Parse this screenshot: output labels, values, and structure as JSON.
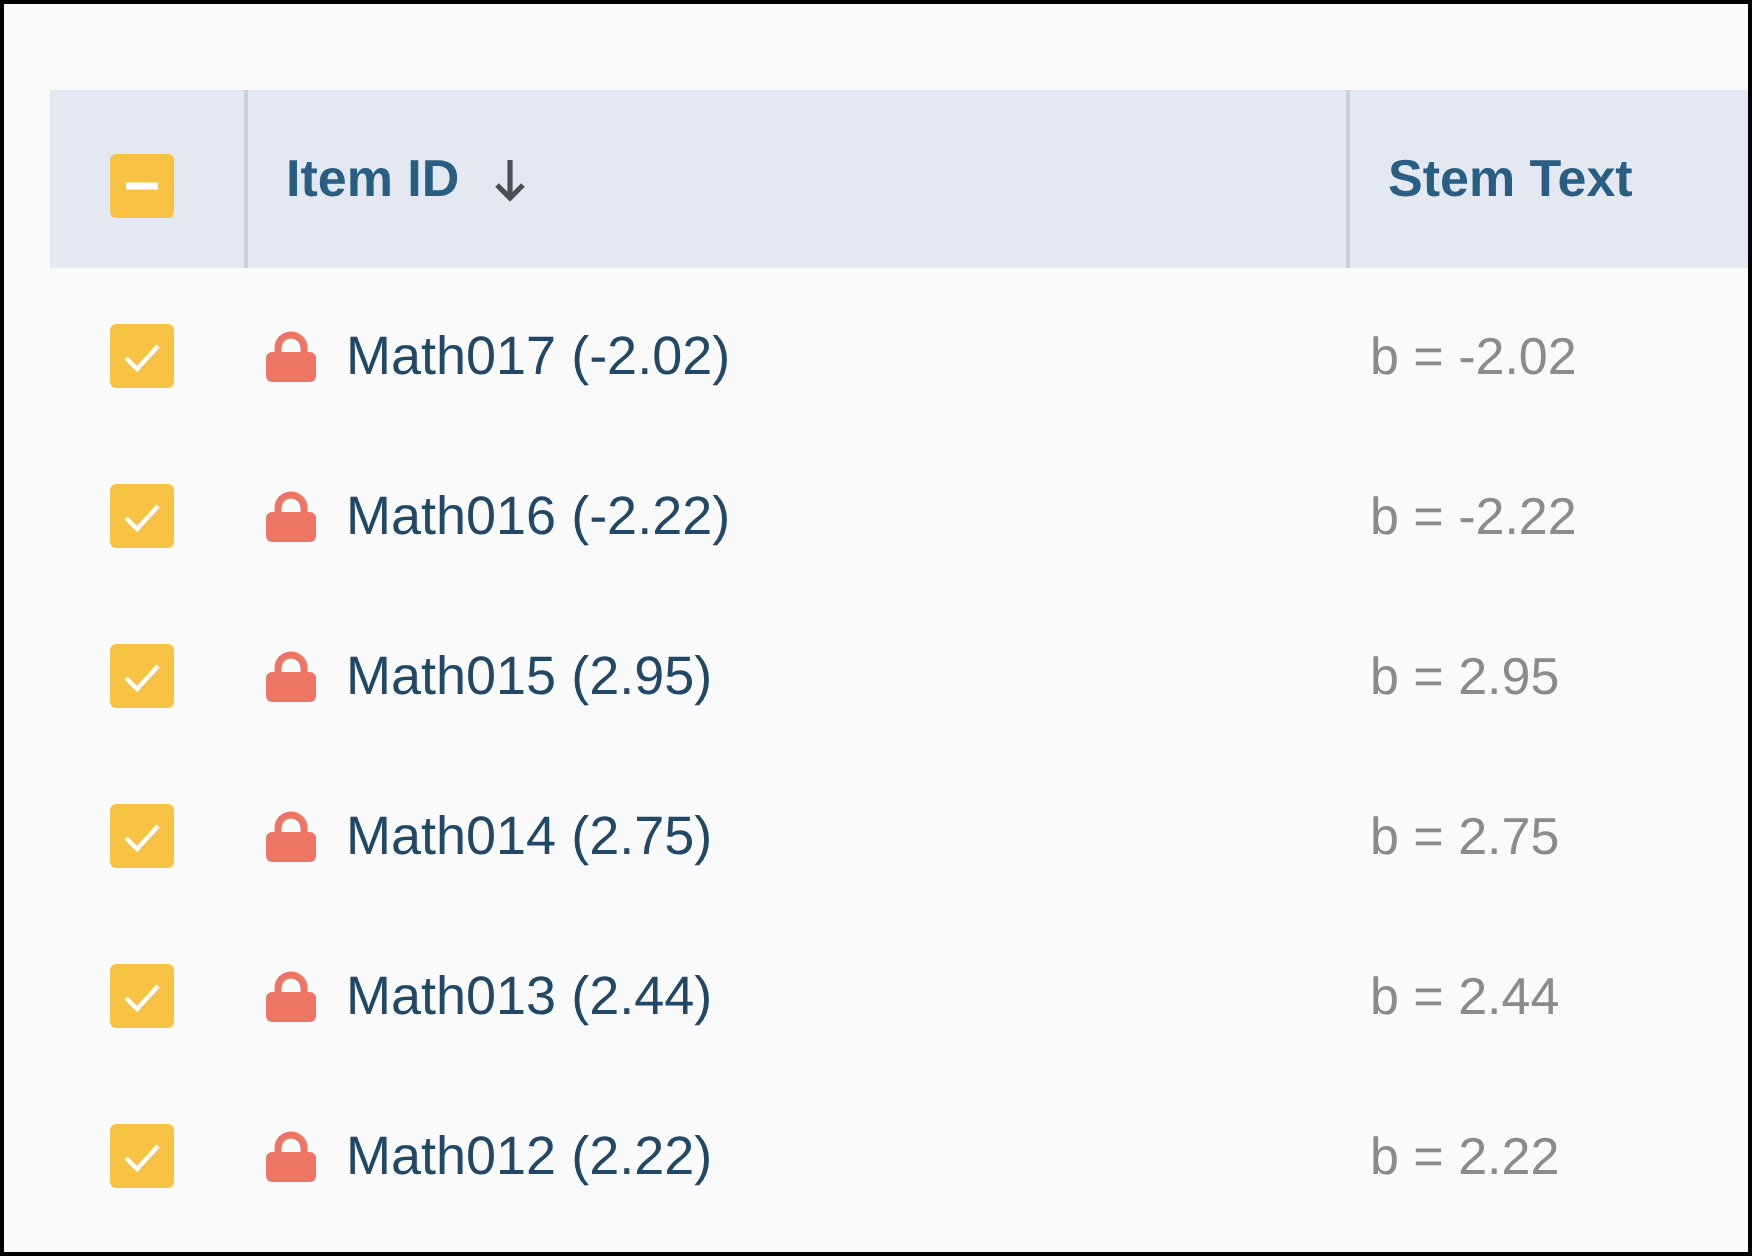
{
  "table": {
    "header_checkbox": {
      "indeterminate": true
    },
    "columns": [
      {
        "label": "Item ID",
        "sorted": true,
        "descending": true
      },
      {
        "label": "Stem Text",
        "sorted": false
      }
    ],
    "rows": [
      {
        "checked": true,
        "locked": true,
        "item_id": "Math017 (-2.02)",
        "stem_text": "b = -2.02"
      },
      {
        "checked": true,
        "locked": true,
        "item_id": "Math016 (-2.22)",
        "stem_text": "b = -2.22"
      },
      {
        "checked": true,
        "locked": true,
        "item_id": "Math015 (2.95)",
        "stem_text": "b = 2.95"
      },
      {
        "checked": true,
        "locked": true,
        "item_id": "Math014 (2.75)",
        "stem_text": "b = 2.75"
      },
      {
        "checked": true,
        "locked": true,
        "item_id": "Math013 (2.44)",
        "stem_text": "b = 2.44"
      },
      {
        "checked": true,
        "locked": true,
        "item_id": "Math012 (2.22)",
        "stem_text": "b = 2.22"
      }
    ]
  }
}
